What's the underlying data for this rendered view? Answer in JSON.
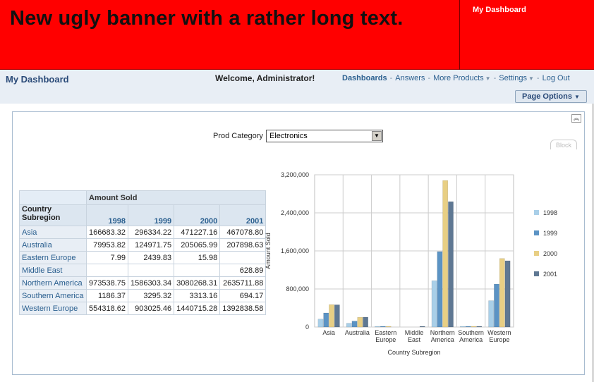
{
  "banner": {
    "title": "New ugly banner with a rather long text.",
    "link": "My Dashboard"
  },
  "header": {
    "title": "My Dashboard",
    "welcome": "Welcome, Administrator!",
    "nav": {
      "dashboards": "Dashboards",
      "answers": "Answers",
      "more_products": "More Products",
      "settings": "Settings",
      "logout": "Log Out"
    },
    "page_options": "Page Options",
    "page_options_caret": "▼"
  },
  "section": {
    "collapse_icon": "chevrons-up-icon",
    "block_tab": "Block"
  },
  "prompt": {
    "label": "Prod Category",
    "value": "Electronics",
    "arrow": "▼"
  },
  "table": {
    "measure": "Amount Sold",
    "row_header": "Country Subregion",
    "years": [
      "1998",
      "1999",
      "2000",
      "2001"
    ],
    "rows": [
      {
        "label": "Asia",
        "values": [
          "166683.32",
          "296334.22",
          "471227.16",
          "467078.80"
        ]
      },
      {
        "label": "Australia",
        "values": [
          "79953.82",
          "124971.75",
          "205065.99",
          "207898.63"
        ]
      },
      {
        "label": "Eastern Europe",
        "values": [
          "7.99",
          "2439.83",
          "15.98",
          ""
        ]
      },
      {
        "label": "Middle East",
        "values": [
          "",
          "",
          "",
          "628.89"
        ]
      },
      {
        "label": "Northern America",
        "values": [
          "973538.75",
          "1586303.34",
          "3080268.31",
          "2635711.88"
        ]
      },
      {
        "label": "Southern America",
        "values": [
          "1186.37",
          "3295.32",
          "3313.16",
          "694.17"
        ]
      },
      {
        "label": "Western Europe",
        "values": [
          "554318.62",
          "903025.46",
          "1440715.28",
          "1392838.58"
        ]
      }
    ]
  },
  "chart_data": {
    "type": "bar",
    "categories": [
      "Asia",
      "Australia",
      "Eastern Europe",
      "Middle East",
      "Northern America",
      "Southern America",
      "Western Europe"
    ],
    "category_lines": [
      [
        "Asia"
      ],
      [
        "Australia"
      ],
      [
        "Eastern",
        "Europe"
      ],
      [
        "Middle",
        "East"
      ],
      [
        "Northern",
        "America"
      ],
      [
        "Southern",
        "America"
      ],
      [
        "Western",
        "Europe"
      ]
    ],
    "series": [
      {
        "name": "1998",
        "color": "#a9cfe8",
        "values": [
          166683.32,
          79953.82,
          7.99,
          0,
          973538.75,
          1186.37,
          554318.62
        ]
      },
      {
        "name": "1999",
        "color": "#5b93c4",
        "values": [
          296334.22,
          124971.75,
          2439.83,
          0,
          1586303.34,
          3295.32,
          903025.46
        ]
      },
      {
        "name": "2000",
        "color": "#e8cf84",
        "values": [
          471227.16,
          205065.99,
          15.98,
          0,
          3080268.31,
          3313.16,
          1440715.28
        ]
      },
      {
        "name": "2001",
        "color": "#5f7893",
        "values": [
          467078.8,
          207898.63,
          0,
          628.89,
          2635711.88,
          694.17,
          1392838.58
        ]
      }
    ],
    "xlabel": "Country Subregion",
    "ylabel": "Amount Sold",
    "ylim": [
      0,
      3200000
    ],
    "yticks": [
      "0",
      "800,000",
      "1,600,000",
      "2,400,000",
      "3,200,000"
    ],
    "grid": true,
    "legend": "right"
  }
}
